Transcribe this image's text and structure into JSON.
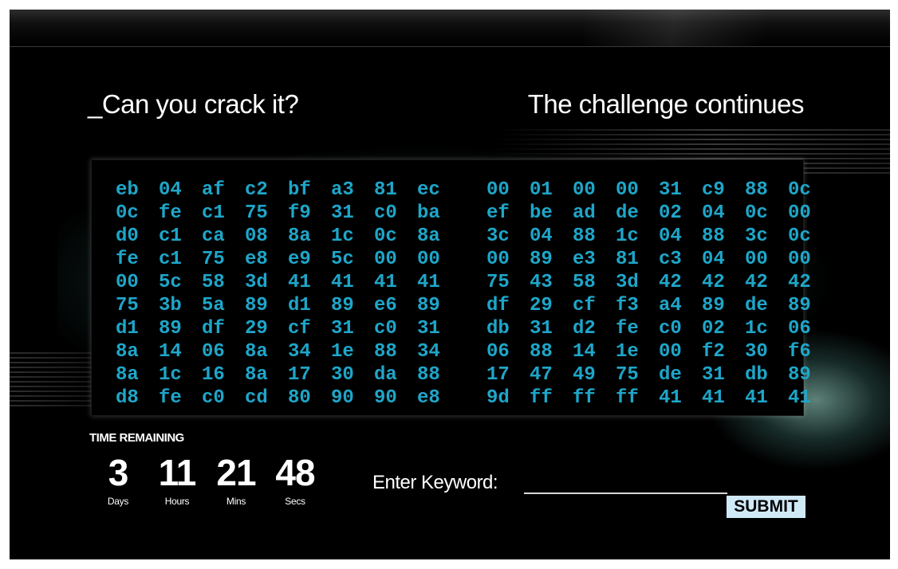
{
  "page": {
    "heading_left": "_Can you crack it?",
    "heading_right": "The challenge continues"
  },
  "hex_dump": {
    "rows": [
      [
        [
          "eb",
          "04",
          "af",
          "c2",
          "bf",
          "a3",
          "81",
          "ec"
        ],
        [
          "00",
          "01",
          "00",
          "00",
          "31",
          "c9",
          "88",
          "0c"
        ]
      ],
      [
        [
          "0c",
          "fe",
          "c1",
          "75",
          "f9",
          "31",
          "c0",
          "ba"
        ],
        [
          "ef",
          "be",
          "ad",
          "de",
          "02",
          "04",
          "0c",
          "00"
        ]
      ],
      [
        [
          "d0",
          "c1",
          "ca",
          "08",
          "8a",
          "1c",
          "0c",
          "8a"
        ],
        [
          "3c",
          "04",
          "88",
          "1c",
          "04",
          "88",
          "3c",
          "0c"
        ]
      ],
      [
        [
          "fe",
          "c1",
          "75",
          "e8",
          "e9",
          "5c",
          "00",
          "00"
        ],
        [
          "00",
          "89",
          "e3",
          "81",
          "c3",
          "04",
          "00",
          "00"
        ]
      ],
      [
        [
          "00",
          "5c",
          "58",
          "3d",
          "41",
          "41",
          "41",
          "41"
        ],
        [
          "75",
          "43",
          "58",
          "3d",
          "42",
          "42",
          "42",
          "42"
        ]
      ],
      [
        [
          "75",
          "3b",
          "5a",
          "89",
          "d1",
          "89",
          "e6",
          "89"
        ],
        [
          "df",
          "29",
          "cf",
          "f3",
          "a4",
          "89",
          "de",
          "89"
        ]
      ],
      [
        [
          "d1",
          "89",
          "df",
          "29",
          "cf",
          "31",
          "c0",
          "31"
        ],
        [
          "db",
          "31",
          "d2",
          "fe",
          "c0",
          "02",
          "1c",
          "06"
        ]
      ],
      [
        [
          "8a",
          "14",
          "06",
          "8a",
          "34",
          "1e",
          "88",
          "34"
        ],
        [
          "06",
          "88",
          "14",
          "1e",
          "00",
          "f2",
          "30",
          "f6"
        ]
      ],
      [
        [
          "8a",
          "1c",
          "16",
          "8a",
          "17",
          "30",
          "da",
          "88"
        ],
        [
          "17",
          "47",
          "49",
          "75",
          "de",
          "31",
          "db",
          "89"
        ]
      ],
      [
        [
          "d8",
          "fe",
          "c0",
          "cd",
          "80",
          "90",
          "90",
          "e8"
        ],
        [
          "9d",
          "ff",
          "ff",
          "ff",
          "41",
          "41",
          "41",
          "41"
        ]
      ]
    ],
    "text_color": "#1ea6c9"
  },
  "countdown": {
    "label": "TIME REMAINING",
    "days": "3",
    "days_label": "Days",
    "hours": "11",
    "hours_label": "Hours",
    "mins": "21",
    "mins_label": "Mins",
    "secs": "48",
    "secs_label": "Secs"
  },
  "keyword_form": {
    "label": "Enter Keyword:",
    "value": "",
    "submit_label": "SUBMIT",
    "submit_bg": "#cfe9f7"
  }
}
